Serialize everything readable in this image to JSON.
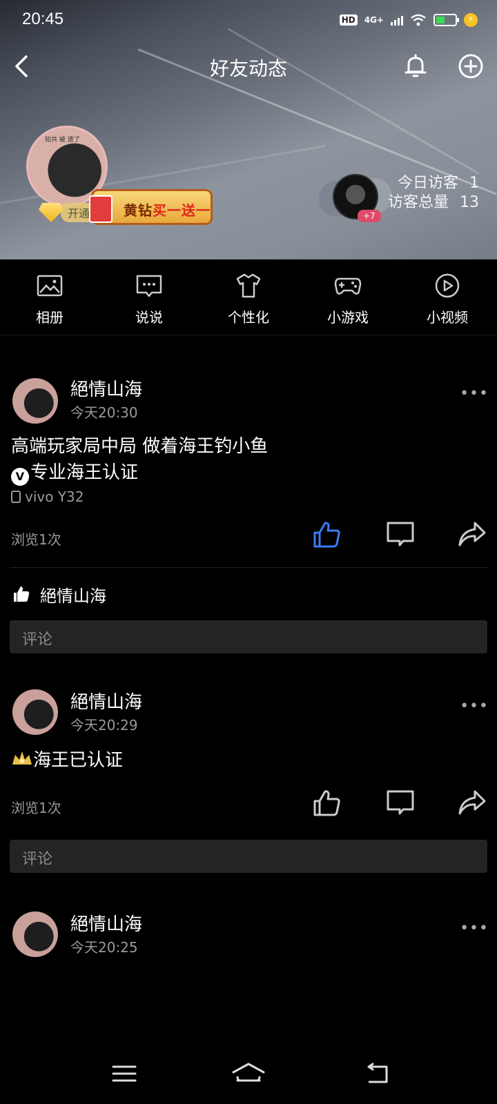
{
  "status": {
    "time": "20:45",
    "hd": "HD",
    "network": "4G+"
  },
  "nav": {
    "title": "好友动态"
  },
  "profile": {
    "avatar_caption": "知共 被 遗了",
    "open_label": "开通",
    "vip_banner_a": "黄钻",
    "vip_banner_b": "买一送一",
    "visitor_more": "+7",
    "today_visitors_label": "今日访客",
    "today_visitors_value": "1",
    "total_visitors_label": "访客总量",
    "total_visitors_value": "13"
  },
  "tabs": [
    {
      "label": "相册",
      "icon": "photo-album-icon"
    },
    {
      "label": "说说",
      "icon": "chat-bubble-icon"
    },
    {
      "label": "个性化",
      "icon": "tshirt-icon"
    },
    {
      "label": "小游戏",
      "icon": "gamepad-icon"
    },
    {
      "label": "小视频",
      "icon": "play-circle-icon"
    }
  ],
  "posts": [
    {
      "name": "絕情山海",
      "time": "今天20:30",
      "line1": "高端玩家局中局  做着海王钓小鱼",
      "badge": "V",
      "line2": "专业海王认证",
      "device": "vivo  Y32",
      "views": "浏览1次",
      "liked_by": "絕情山海",
      "comment_placeholder": "评论",
      "liked": true
    },
    {
      "name": "絕情山海",
      "time": "今天20:29",
      "text": "海王已认证",
      "views": "浏览1次",
      "comment_placeholder": "评论",
      "liked": false
    },
    {
      "name": "絕情山海",
      "time": "今天20:25"
    }
  ],
  "colors": {
    "like_active": "#3b7cf6",
    "background": "#000000",
    "comment_box": "#242424"
  }
}
